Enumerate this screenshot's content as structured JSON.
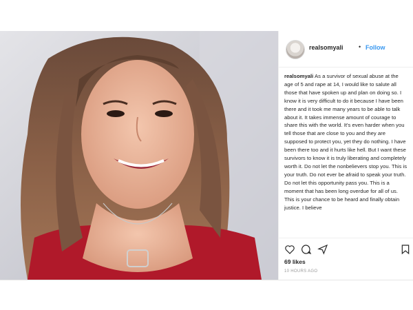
{
  "post": {
    "username": "realsomyali",
    "separator": "•",
    "follow_label": "Follow",
    "caption_user": "realsomyali",
    "caption_text": "As a survivor of sexual abuse at the age of 5 and rape at 14, I would like to salute all those that have spoken up and plan on doing so. I know it is very difficult to do it because I have been there and it took me many years to be able to talk about it. It takes immense amount of courage to share this with the world. It's even harder when you tell those that are close to you and they are supposed to protect you, yet they do nothing. I have been there too and it hurts like hell. But I want these survivors to know it is truly liberating and completely worth it. Do not let the nonbelievers stop you. This is your truth. Do not ever be afraid to speak your truth. Do not let this opportunity pass you. This is a moment that has been long overdue for all of us. This is your chance to be heard and finally obtain justice. I believe",
    "likes": "69 likes",
    "timestamp": "10 HOURS AGO"
  },
  "icons": {
    "avatar": "profile-avatar",
    "like": "heart-icon",
    "comment": "comment-icon",
    "share": "share-icon",
    "save": "bookmark-icon"
  },
  "colors": {
    "follow": "#3897f0",
    "text": "#262626",
    "muted": "#999999"
  }
}
